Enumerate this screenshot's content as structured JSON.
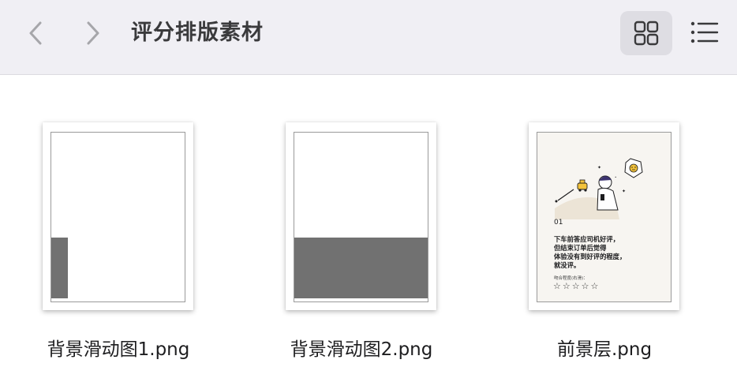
{
  "toolbar": {
    "title": "评分排版素材",
    "back_icon": "chevron-left-icon",
    "forward_icon": "chevron-right-icon",
    "grid_view_icon": "grid-view-icon",
    "list_view_icon": "list-view-icon"
  },
  "files": [
    {
      "name": "背景滑动图1.png"
    },
    {
      "name": "背景滑动图2.png"
    },
    {
      "name": "前景层.png",
      "preview": {
        "number": "01",
        "lines": [
          "下车前答应司机好评，",
          "但结束订单后觉得",
          "体验没有到好评的程度，",
          "就没评。"
        ],
        "rating_label": "吻合程度(右滑)：",
        "stars": "☆☆☆☆☆"
      }
    }
  ],
  "colors": {
    "toolbar_bg": "#f0eff4",
    "selected_view_bg": "#dedde3",
    "placeholder_gray": "#717171"
  }
}
